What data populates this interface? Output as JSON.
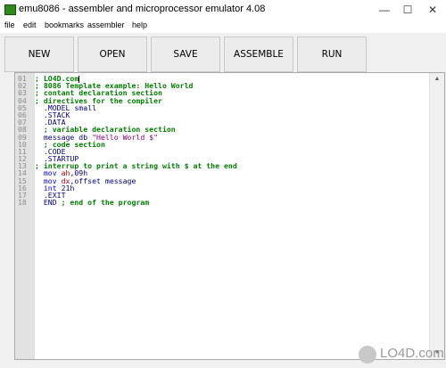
{
  "window": {
    "title": "emu8086 - assembler and microprocessor emulator 4.08"
  },
  "menu": [
    "file",
    "edit",
    "bookmarks",
    "assembler",
    "help"
  ],
  "toolbar": [
    "NEW",
    "OPEN",
    "SAVE",
    "ASSEMBLE",
    "RUN"
  ],
  "editor": {
    "lines": [
      {
        "num": "01",
        "text": "; LO4D.com",
        "kind": "comment"
      },
      {
        "num": "02",
        "text": "; 8086 Template example: Hello World",
        "kind": "comment"
      },
      {
        "num": "03",
        "text": "; contant declaration section",
        "kind": "comment"
      },
      {
        "num": "04",
        "text": "; directives for the compiler",
        "kind": "comment"
      },
      {
        "num": "05",
        "text": "  .MODEL small",
        "kind": "dir"
      },
      {
        "num": "06",
        "text": "  .STACK",
        "kind": "dir"
      },
      {
        "num": "07",
        "text": "  .DATA",
        "kind": "dir"
      },
      {
        "num": "08",
        "text": "  ; variable declaration section",
        "kind": "comment"
      },
      {
        "num": "09",
        "text": "  message db \"Hello World $\"",
        "kind": "str"
      },
      {
        "num": "10",
        "text": "  ; code section",
        "kind": "comment"
      },
      {
        "num": "11",
        "text": "  .CODE",
        "kind": "dir"
      },
      {
        "num": "12",
        "text": "  .STARTUP",
        "kind": "dir"
      },
      {
        "num": "13",
        "text": "; interrup to print a string with $ at the end",
        "kind": "comment"
      },
      {
        "num": "14",
        "text": "  mov ah,09h",
        "kind": "ins"
      },
      {
        "num": "15",
        "text": "  mov dx,offset message",
        "kind": "ins"
      },
      {
        "num": "16",
        "text": "  int 21h",
        "kind": "ins"
      },
      {
        "num": "17",
        "text": "  .EXIT",
        "kind": "dir"
      },
      {
        "num": "18",
        "text": "  END ; end of the program",
        "kind": "end"
      }
    ]
  },
  "watermark": {
    "text": "LO4D.com"
  }
}
